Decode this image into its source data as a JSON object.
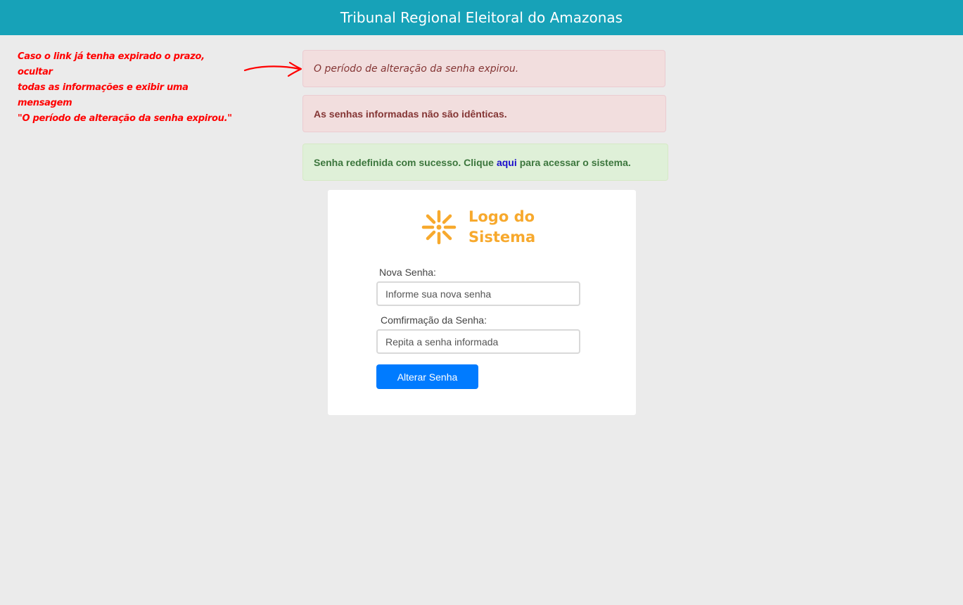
{
  "header": {
    "title": "Tribunal Regional Eleitoral do Amazonas",
    "background_color": "#17a2b8"
  },
  "annotation": {
    "line1": "Caso o link já tenha expirado o prazo, ocultar",
    "line2": "todas as informações e exibir uma mensagem",
    "line3": "\"O período de alteração da senha expirou.\"",
    "color": "#ff0000"
  },
  "alerts": {
    "expired": "O período de alteração da senha expirou.",
    "mismatch": "As senhas informadas não são idênticas.",
    "success": {
      "before": "Senha redefinida com sucesso. Clique",
      "link": "aqui",
      "after": "para acessar o sistema."
    }
  },
  "logo": {
    "line1": "Logo do",
    "line2": "Sistema",
    "icon": "asterisk-sun-icon",
    "color": "#f7a92d"
  },
  "form": {
    "new_password_label": "Nova Senha:",
    "new_password_placeholder": "Informe sua nova senha",
    "confirm_password_label": "Comfirmação da Senha:",
    "confirm_password_placeholder": "Repita a senha informada",
    "submit_label": "Alterar Senha",
    "submit_color": "#007bff"
  }
}
